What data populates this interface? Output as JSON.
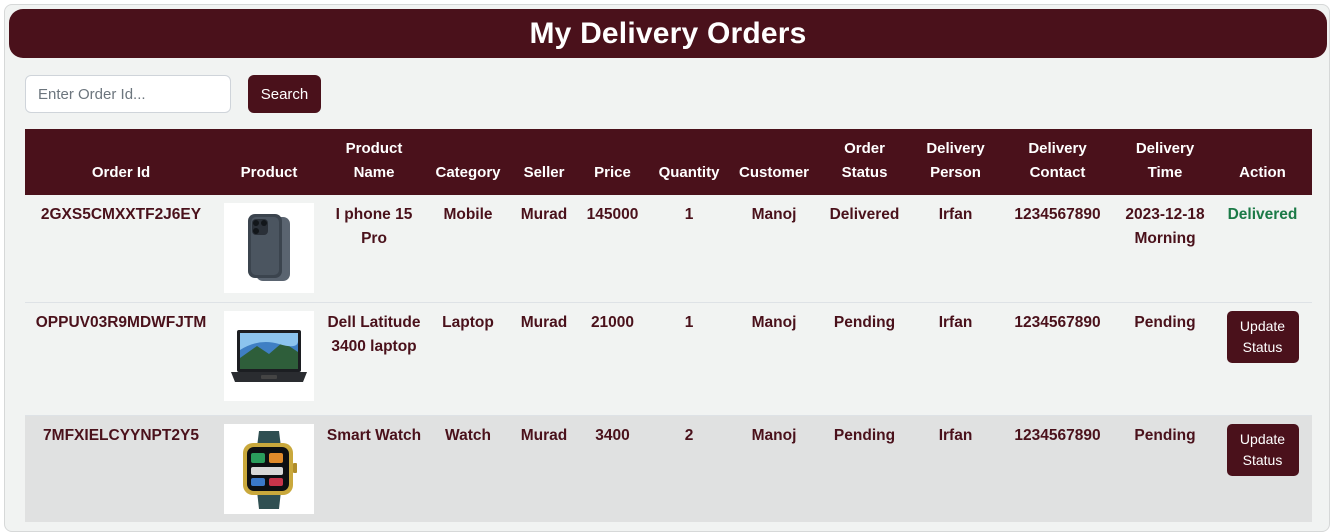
{
  "page": {
    "title": "My Delivery Orders"
  },
  "search": {
    "placeholder": "Enter Order Id...",
    "button_label": "Search"
  },
  "table": {
    "columns": [
      "Order Id",
      "Product",
      "Product Name",
      "Category",
      "Seller",
      "Price",
      "Quantity",
      "Customer",
      "Order Status",
      "Delivery Person",
      "Delivery Contact",
      "Delivery Time",
      "Action"
    ],
    "rows": [
      {
        "order_id": "2GXS5CMXXTF2J6EY",
        "product_image": "iphone-image",
        "product_name": "I phone 15 Pro",
        "category": "Mobile",
        "seller": "Murad",
        "price": "145000",
        "quantity": "1",
        "customer": "Manoj",
        "order_status": "Delivered",
        "delivery_person": "Irfan",
        "delivery_contact": "1234567890",
        "delivery_time": "2023-12-18 Morning",
        "action": "Delivered"
      },
      {
        "order_id": "OPPUV03R9MDWFJTM",
        "product_image": "laptop-image",
        "product_name": "Dell Latitude 3400 laptop",
        "category": "Laptop",
        "seller": "Murad",
        "price": "21000",
        "quantity": "1",
        "customer": "Manoj",
        "order_status": "Pending",
        "delivery_person": "Irfan",
        "delivery_contact": "1234567890",
        "delivery_time": "Pending",
        "action": "Update Status"
      },
      {
        "order_id": "7MFXIELCYYNPT2Y5",
        "product_image": "smartwatch-image",
        "product_name": "Smart Watch",
        "category": "Watch",
        "seller": "Murad",
        "price": "3400",
        "quantity": "2",
        "customer": "Manoj",
        "order_status": "Pending",
        "delivery_person": "Irfan",
        "delivery_contact": "1234567890",
        "delivery_time": "Pending",
        "action": "Update Status"
      }
    ]
  },
  "colors": {
    "brand": "#4a111b",
    "delivered": "#1b7a47",
    "background": "#f1f3f2"
  }
}
